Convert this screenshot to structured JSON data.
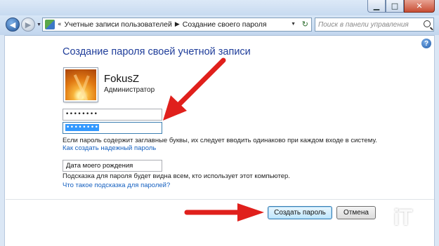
{
  "window": {
    "minimize_label": "▁",
    "maximize_label": "□",
    "close_label": "✕"
  },
  "nav": {
    "back_label": "◀",
    "forward_label": "▶",
    "breadcrumb_prefix": "«",
    "breadcrumb": [
      "Учетные записи пользователей",
      "Создание своего пароля"
    ],
    "breadcrumb_sep": "▶",
    "refresh_label": "↻",
    "search_placeholder": "Поиск в панели управления"
  },
  "help_label": "?",
  "page": {
    "heading": "Создание пароля своей учетной записи",
    "user": {
      "name": "FokusZ",
      "role": "Администратор"
    },
    "password_value": "••••••••",
    "confirm_value": "••••••••",
    "password_note": "Если пароль содержит заглавные буквы, их следует вводить одинаково при каждом входе в систему.",
    "strong_password_link": "Как создать надежный пароль",
    "hint_value": "Дата моего рождения",
    "hint_note": "Подсказка для пароля будет видна всем, кто использует этот компьютер.",
    "hint_link": "Что такое подсказка для паролей?"
  },
  "buttons": {
    "create": "Создать пароль",
    "cancel": "Отмена"
  },
  "watermark": "iT",
  "colors": {
    "heading": "#1f3d9a",
    "link": "#1560c0",
    "arrow": "#e0201c",
    "selection": "#3399ff"
  }
}
